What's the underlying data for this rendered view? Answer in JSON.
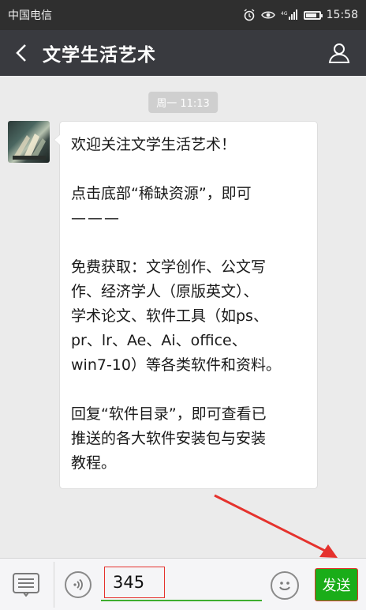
{
  "status_bar": {
    "carrier": "中国电信",
    "network_label": "4G",
    "time": "15:58",
    "icons": [
      "alarm-icon",
      "eye-icon",
      "signal-icon",
      "battery-icon"
    ]
  },
  "title_bar": {
    "title": "文学生活艺术",
    "back_icon": "chevron-left-icon",
    "profile_icon": "person-icon"
  },
  "chat": {
    "timestamp": "周一 11:13",
    "message": {
      "line_1": "欢迎关注文学生活艺术！",
      "line_2": "点击底部“稀缺资源”，即可",
      "line_3": "———",
      "line_4": "免费获取：文学创作、公文写",
      "line_5": "作、经济学人（原版英文）、",
      "line_6": "学术论文、软件工具（如ps、",
      "line_7": "pr、lr、Ae、Ai、office、",
      "line_8": "win7-10）等各类软件和资料。",
      "line_9": "回复“软件目录”，即可查看已",
      "line_10": "推送的各大软件安装包与安装",
      "line_11": "教程。"
    }
  },
  "input_bar": {
    "menu_icon": "menu-list-icon",
    "voice_icon": "voice-icon",
    "typed_value": "345",
    "emoji_icon": "emoji-icon",
    "send_label": "发送"
  },
  "colors": {
    "title_bar_bg": "#393a3f",
    "status_bar_bg": "#2f2f2f",
    "chat_bg": "#ebebeb",
    "send_button": "#1aad19",
    "highlight_red": "#e5322d",
    "input_underline": "#3fae2f"
  }
}
